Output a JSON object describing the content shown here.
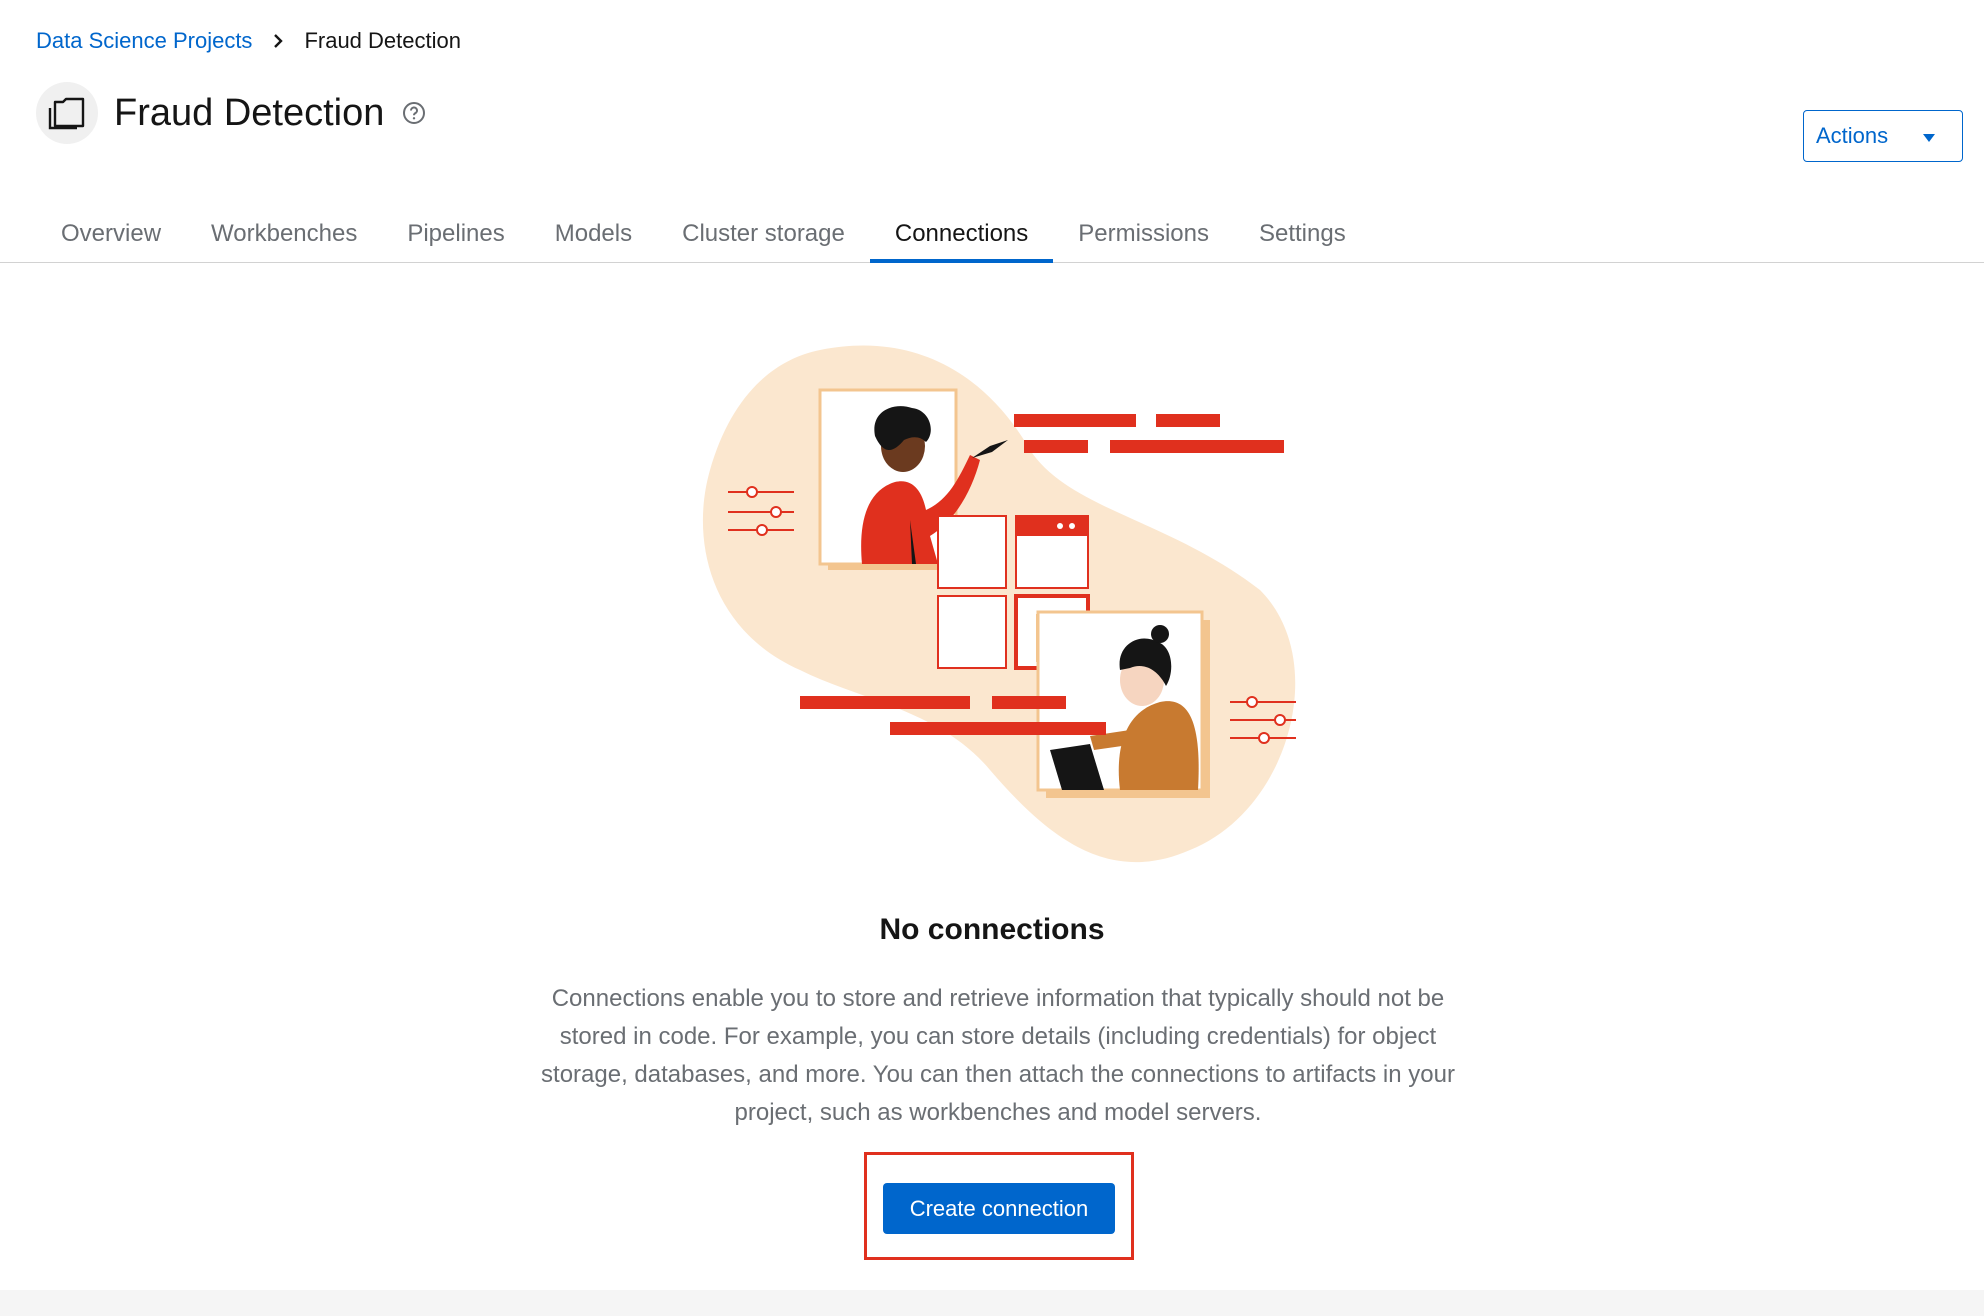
{
  "breadcrumb": {
    "parent": "Data Science Projects",
    "current": "Fraud Detection"
  },
  "header": {
    "title": "Fraud Detection",
    "actions_label": "Actions"
  },
  "tabs": [
    {
      "label": "Overview",
      "active": false
    },
    {
      "label": "Workbenches",
      "active": false
    },
    {
      "label": "Pipelines",
      "active": false
    },
    {
      "label": "Models",
      "active": false
    },
    {
      "label": "Cluster storage",
      "active": false
    },
    {
      "label": "Connections",
      "active": true
    },
    {
      "label": "Permissions",
      "active": false
    },
    {
      "label": "Settings",
      "active": false
    }
  ],
  "empty_state": {
    "title": "No connections",
    "body": "Connections enable you to store and retrieve information that typically should not be stored in code. For example, you can store details (including credentials) for object storage, databases, and more. You can then attach the connections to artifacts in your project, such as workbenches and model servers.",
    "button_label": "Create connection"
  },
  "colors": {
    "accent": "#0066cc",
    "illustration_red": "#e0301e",
    "illustration_blob": "#fbe7cf",
    "highlight": "#e0301e"
  },
  "icons": {
    "project": "project-folder-icon",
    "help": "help-circle-icon",
    "breadcrumb_separator": "chevron-right-icon",
    "actions_caret": "caret-down-icon"
  }
}
